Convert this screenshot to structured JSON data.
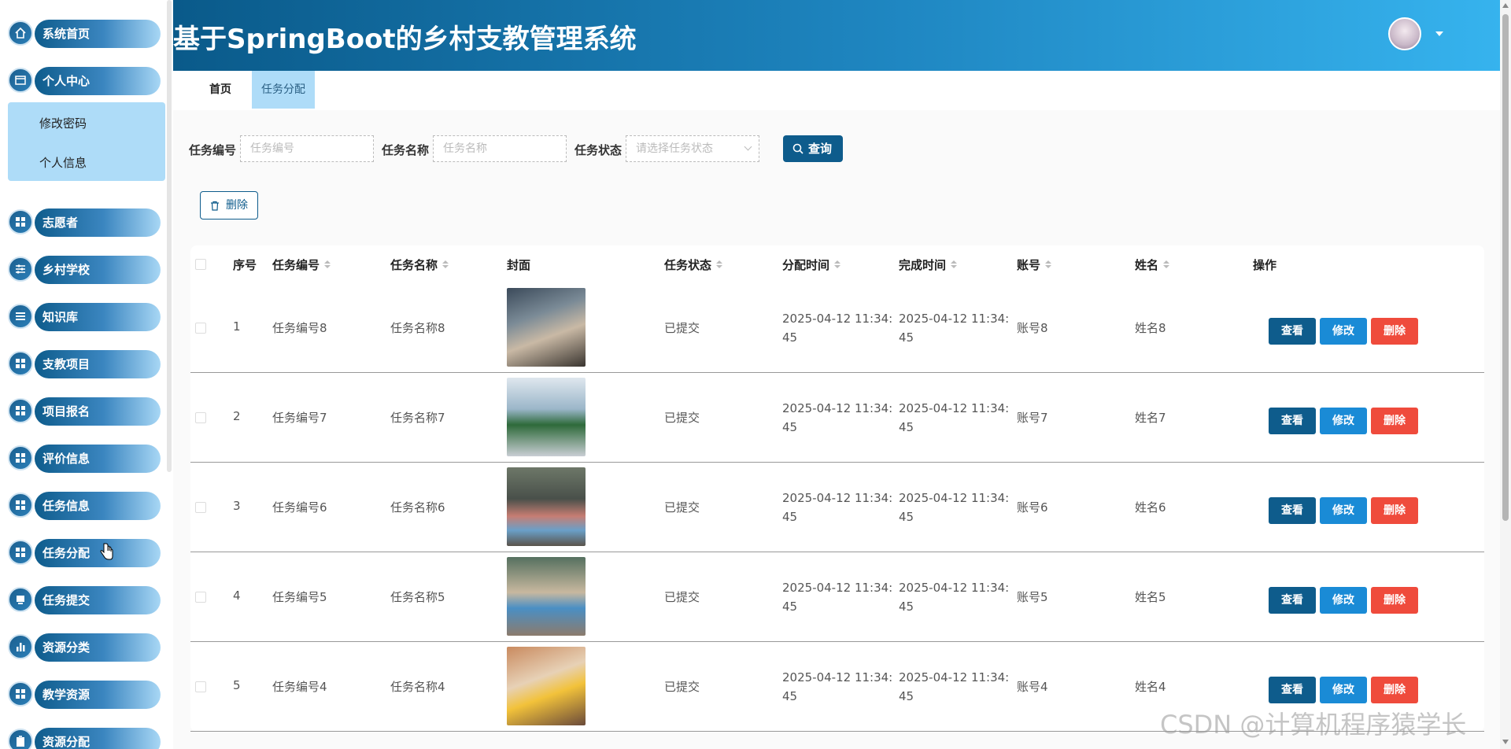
{
  "app": {
    "title": "基于SpringBoot的乡村支教管理系统"
  },
  "sidebar": {
    "items": [
      {
        "label": "系统首页",
        "icon": "home-icon"
      },
      {
        "label": "个人中心",
        "icon": "profile-icon"
      },
      {
        "label": "志愿者",
        "icon": "grid-icon"
      },
      {
        "label": "乡村学校",
        "icon": "sliders-icon"
      },
      {
        "label": "知识库",
        "icon": "list-icon"
      },
      {
        "label": "支教项目",
        "icon": "grid-icon"
      },
      {
        "label": "项目报名",
        "icon": "grid-icon"
      },
      {
        "label": "评价信息",
        "icon": "grid-icon"
      },
      {
        "label": "任务信息",
        "icon": "grid-icon"
      },
      {
        "label": "任务分配",
        "icon": "grid-icon"
      },
      {
        "label": "任务提交",
        "icon": "monitor-icon"
      },
      {
        "label": "资源分类",
        "icon": "bar-chart-icon"
      },
      {
        "label": "教学资源",
        "icon": "grid-icon"
      },
      {
        "label": "资源分配",
        "icon": "clipboard-icon"
      }
    ],
    "submenu": [
      {
        "label": "修改密码"
      },
      {
        "label": "个人信息"
      }
    ]
  },
  "tabs": [
    {
      "label": "首页"
    },
    {
      "label": "任务分配"
    }
  ],
  "search": {
    "fields": [
      {
        "label": "任务编号",
        "placeholder": "任务编号"
      },
      {
        "label": "任务名称",
        "placeholder": "任务名称"
      },
      {
        "label": "任务状态",
        "placeholder": "请选择任务状态"
      }
    ],
    "button_label": "查询"
  },
  "toolbar": {
    "delete_label": "删除"
  },
  "table": {
    "headers": {
      "index": "序号",
      "task_no": "任务编号",
      "task_name": "任务名称",
      "cover": "封面",
      "status": "任务状态",
      "assign_time": "分配时间",
      "finish_time": "完成时间",
      "account": "账号",
      "name": "姓名",
      "actions": "操作"
    },
    "rows": [
      {
        "index": "1",
        "task_no": "任务编号8",
        "task_name": "任务名称8",
        "status": "已提交",
        "assign_time": "2025-04-12 11:34:45",
        "finish_time": "2025-04-12 11:34:45",
        "account": "账号8",
        "name": "姓名8"
      },
      {
        "index": "2",
        "task_no": "任务编号7",
        "task_name": "任务名称7",
        "status": "已提交",
        "assign_time": "2025-04-12 11:34:45",
        "finish_time": "2025-04-12 11:34:45",
        "account": "账号7",
        "name": "姓名7"
      },
      {
        "index": "3",
        "task_no": "任务编号6",
        "task_name": "任务名称6",
        "status": "已提交",
        "assign_time": "2025-04-12 11:34:45",
        "finish_time": "2025-04-12 11:34:45",
        "account": "账号6",
        "name": "姓名6"
      },
      {
        "index": "4",
        "task_no": "任务编号5",
        "task_name": "任务名称5",
        "status": "已提交",
        "assign_time": "2025-04-12 11:34:45",
        "finish_time": "2025-04-12 11:34:45",
        "account": "账号5",
        "name": "姓名5"
      },
      {
        "index": "5",
        "task_no": "任务编号4",
        "task_name": "任务名称4",
        "status": "已提交",
        "assign_time": "2025-04-12 11:34:45",
        "finish_time": "2025-04-12 11:34:45",
        "account": "账号4",
        "name": "姓名4"
      }
    ],
    "actions": {
      "view": "查看",
      "edit": "修改",
      "delete": "删除"
    }
  },
  "watermark": "CSDN @计算机程序猿学长",
  "colors": {
    "primary": "#0e5c8c",
    "edit": "#1a8bd6",
    "danger": "#ef4b3c",
    "submenu_bg": "#aedcf8"
  }
}
